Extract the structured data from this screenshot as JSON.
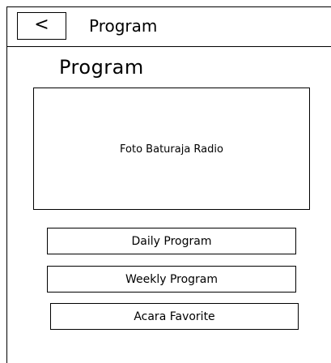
{
  "header": {
    "back_label": "<",
    "title": "Program"
  },
  "main": {
    "page_title": "Program",
    "photo_placeholder": "Foto Baturaja Radio",
    "buttons": [
      {
        "label": "Daily Program"
      },
      {
        "label": "Weekly Program"
      },
      {
        "label": "Acara Favorite"
      }
    ]
  }
}
